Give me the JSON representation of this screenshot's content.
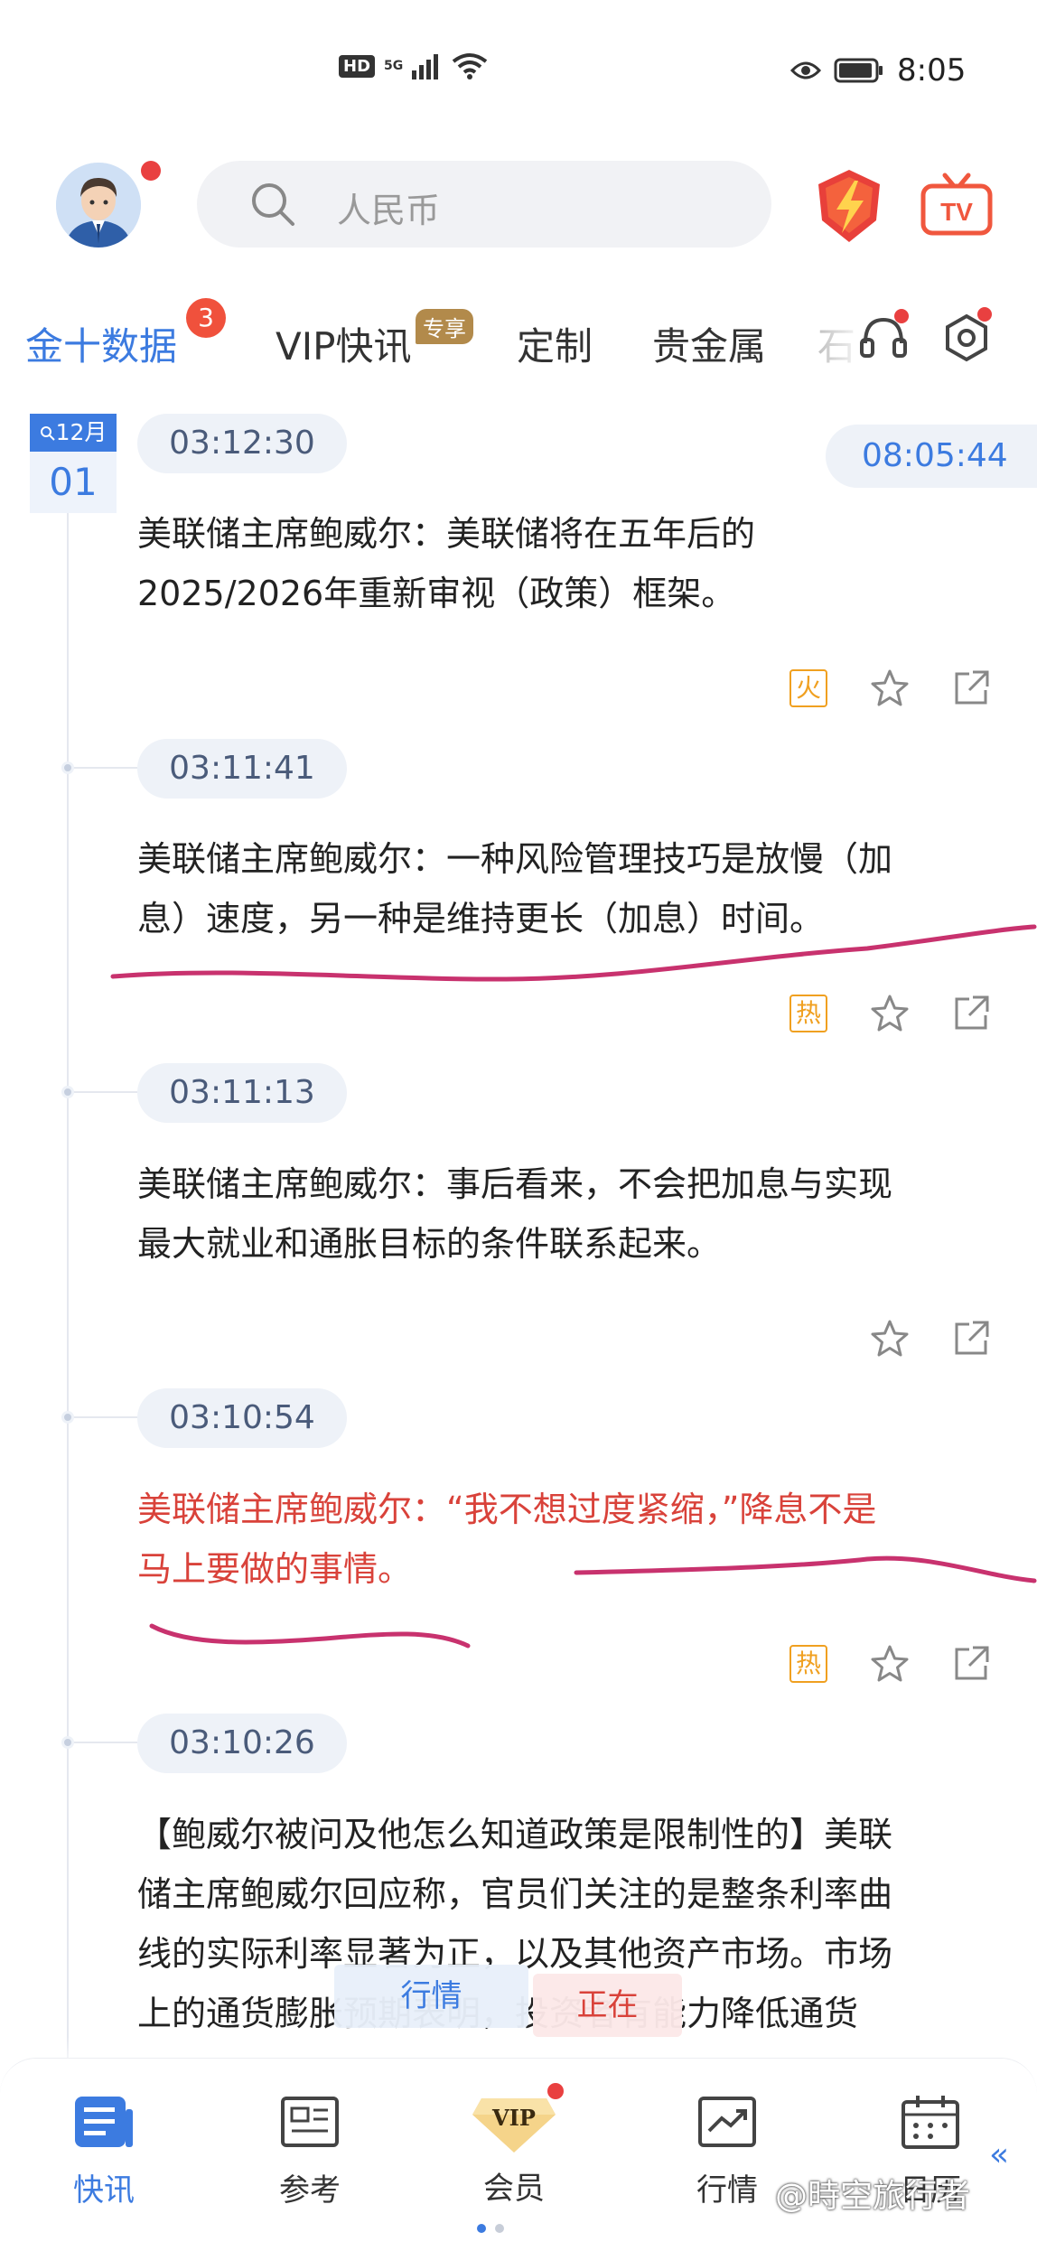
{
  "status_bar": {
    "hd_label": "HD",
    "network_label": "5G",
    "time": "8:05"
  },
  "header": {
    "search_placeholder": "人民币"
  },
  "tabs": [
    {
      "label": "金十数据",
      "badge": "3",
      "active": true
    },
    {
      "label": "VIP快讯",
      "tag": "专享"
    },
    {
      "label": "定制"
    },
    {
      "label": "贵金属"
    },
    {
      "label": "石"
    }
  ],
  "date": {
    "month": "12月",
    "day": "01",
    "current_time": "08:05:44"
  },
  "feed": [
    {
      "time": "03:12:30",
      "text_lines": [
        "美联储主席鲍威尔：美联储将在五年后的",
        "2025/2026年重新审视（政策）框架。"
      ],
      "badge": "火",
      "highlight": false
    },
    {
      "time": "03:11:41",
      "text_lines": [
        "美联储主席鲍威尔：一种风险管理技巧是放慢（加",
        "息）速度，另一种是维持更长（加息）时间。"
      ],
      "badge": "热",
      "highlight": false
    },
    {
      "time": "03:11:13",
      "text_lines": [
        "美联储主席鲍威尔：事后看来，不会把加息与实现",
        "最大就业和通胀目标的条件联系起来。"
      ],
      "badge": "",
      "highlight": false
    },
    {
      "time": "03:10:54",
      "text_lines": [
        "美联储主席鲍威尔：“我不想过度紧缩，”降息不是",
        "马上要做的事情。"
      ],
      "badge": "热",
      "highlight": true
    },
    {
      "time": "03:10:26",
      "text_lines": [
        "【鲍威尔被问及他怎么知道政策是限制性的】美联",
        "储主席鲍威尔回应称，官员们关注的是整条利率曲",
        "线的实际利率显著为正，以及其他资产市场。市场",
        "上的通货膨胀预期表明，投资者有能力降低通货"
      ],
      "badge": "",
      "highlight": false
    }
  ],
  "floating": {
    "market": "行情",
    "live": "正在"
  },
  "bottom_nav": [
    {
      "label": "快讯",
      "icon": "news-icon",
      "active": true
    },
    {
      "label": "参考",
      "icon": "reference-icon"
    },
    {
      "label": "会员",
      "icon": "vip-icon"
    },
    {
      "label": "行情",
      "icon": "chart-icon"
    },
    {
      "label": "日历",
      "icon": "calendar-icon"
    }
  ],
  "vip_icon_text": "VIP",
  "watermark": "@時空旅行者",
  "colors": {
    "accent": "#3c7be0",
    "hot": "#f0a020",
    "highlight_text": "#d9423a",
    "annotation": "#c8326e"
  }
}
